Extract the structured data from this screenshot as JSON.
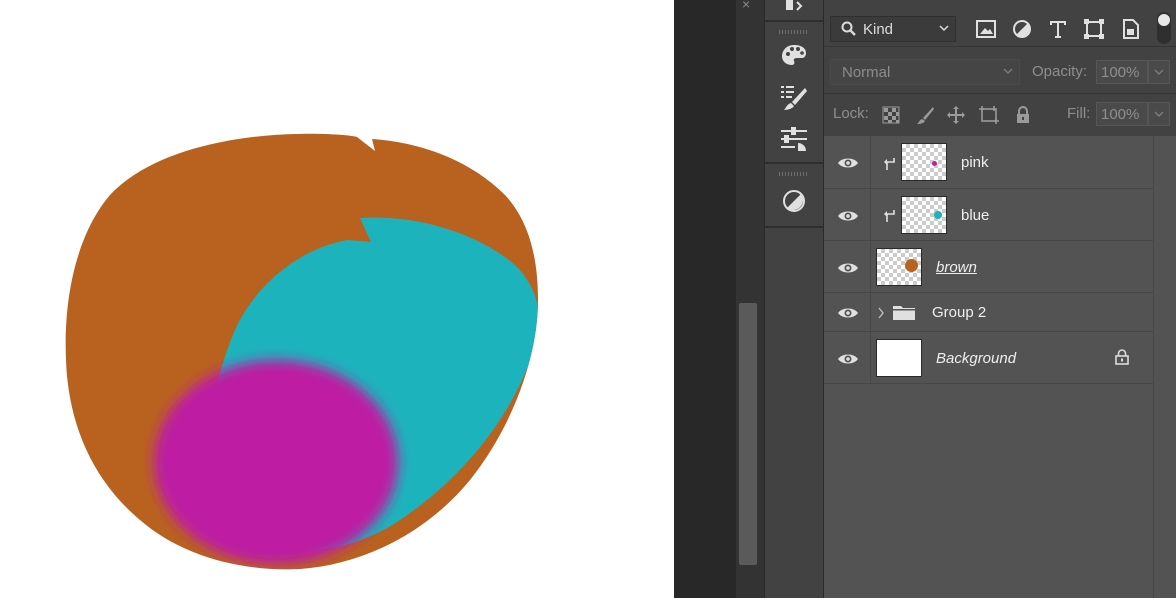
{
  "canvas": {
    "background": "#ffffff",
    "shapes": [
      {
        "name": "brown",
        "color": "#b9621f"
      },
      {
        "name": "blue",
        "color": "#1db3bd"
      },
      {
        "name": "pink",
        "color": "#bd1ea3"
      }
    ]
  },
  "document": {
    "close_glyph": "×"
  },
  "tools": [
    {
      "name": "properties-icon"
    },
    {
      "name": "color-palette-icon"
    },
    {
      "name": "brush-settings-icon"
    },
    {
      "name": "adjustments-icon"
    },
    {
      "name": "contrast-icon"
    }
  ],
  "layers_panel": {
    "filter": {
      "label": "Kind"
    },
    "filter_icons": [
      "image-filter-icon",
      "adjustment-filter-icon",
      "type-filter-icon",
      "shape-filter-icon",
      "smart-object-filter-icon"
    ],
    "blend_mode": "Normal",
    "opacity_label": "Opacity:",
    "opacity_value": "100%",
    "lock_label": "Lock:",
    "fill_label": "Fill:",
    "fill_value": "100%",
    "layers": [
      {
        "name": "pink",
        "clipped": true,
        "dot_color": "#bd1ea3",
        "visible": true
      },
      {
        "name": "blue",
        "clipped": true,
        "dot_color": "#1db3bd",
        "visible": true
      },
      {
        "name": "brown",
        "clipped": false,
        "dot_color": "#b9621f",
        "visible": true
      },
      {
        "name": "Group 2",
        "type": "group",
        "visible": true
      },
      {
        "name": "Background",
        "type": "background",
        "locked": true,
        "visible": true
      }
    ]
  },
  "colors": {
    "panel_bg": "#535353",
    "toolbar_bg": "#424242",
    "text": "#efefef"
  }
}
